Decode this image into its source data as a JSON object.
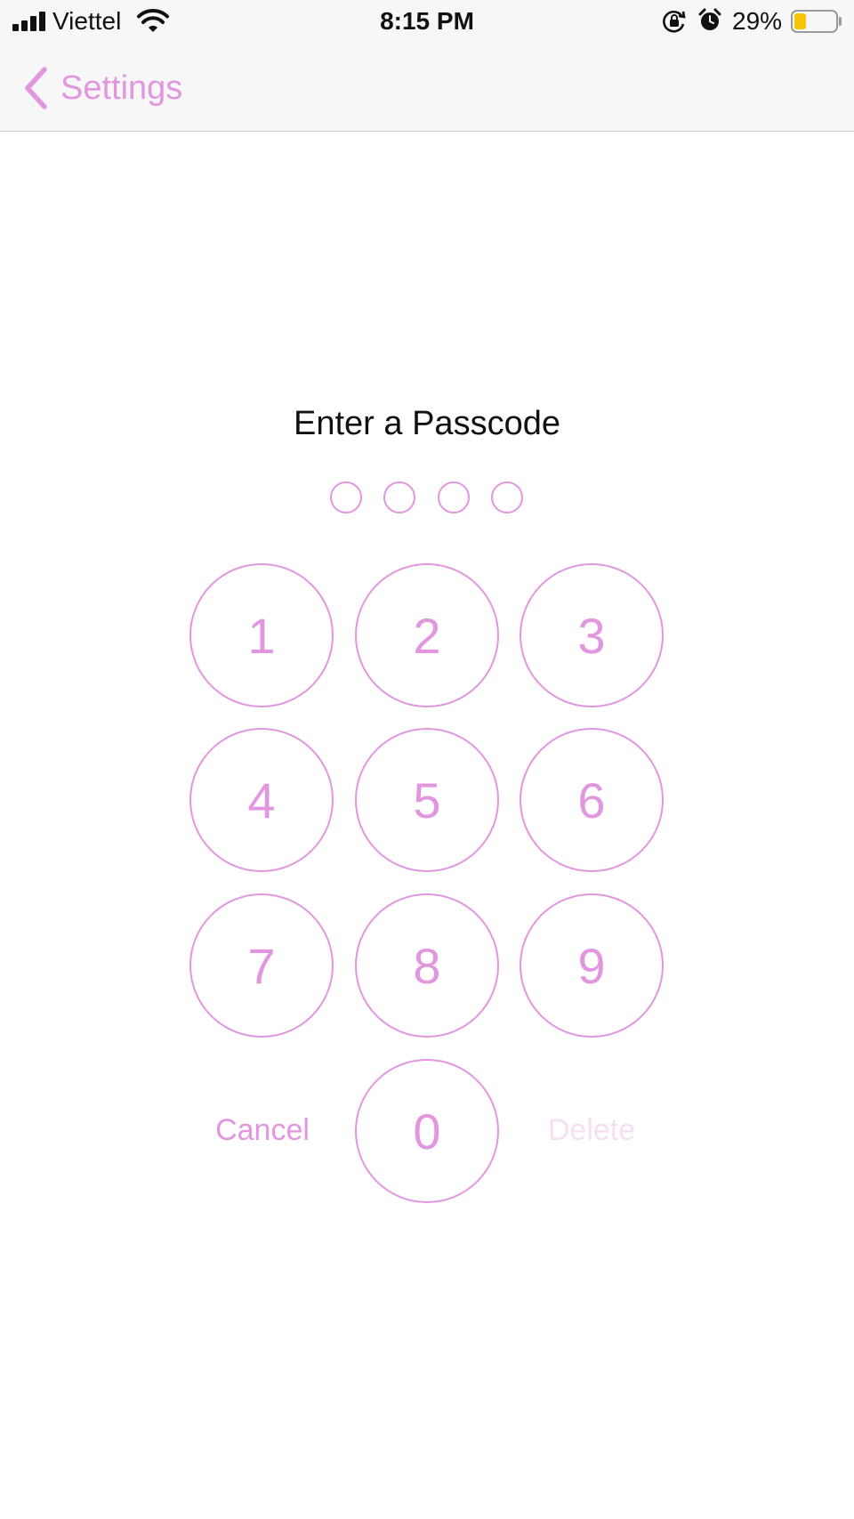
{
  "status_bar": {
    "carrier": "Viettel",
    "time": "8:15 PM",
    "battery_percent": "29%",
    "battery_level": 0.29,
    "icons": [
      "signal-bars-icon",
      "wifi-icon",
      "rotation-lock-icon",
      "alarm-icon",
      "battery-icon"
    ]
  },
  "nav": {
    "back_label": "Settings"
  },
  "passcode": {
    "title": "Enter a Passcode",
    "digits_entered": 0,
    "digits_total": 4
  },
  "keypad": {
    "keys": [
      "1",
      "2",
      "3",
      "4",
      "5",
      "6",
      "7",
      "8",
      "9",
      "0"
    ],
    "cancel_label": "Cancel",
    "delete_label": "Delete"
  },
  "colors": {
    "accent": "#e296e0",
    "disabled_accent": "#f6dff5",
    "text": "#111111",
    "bar_background": "#f7f7f7"
  }
}
